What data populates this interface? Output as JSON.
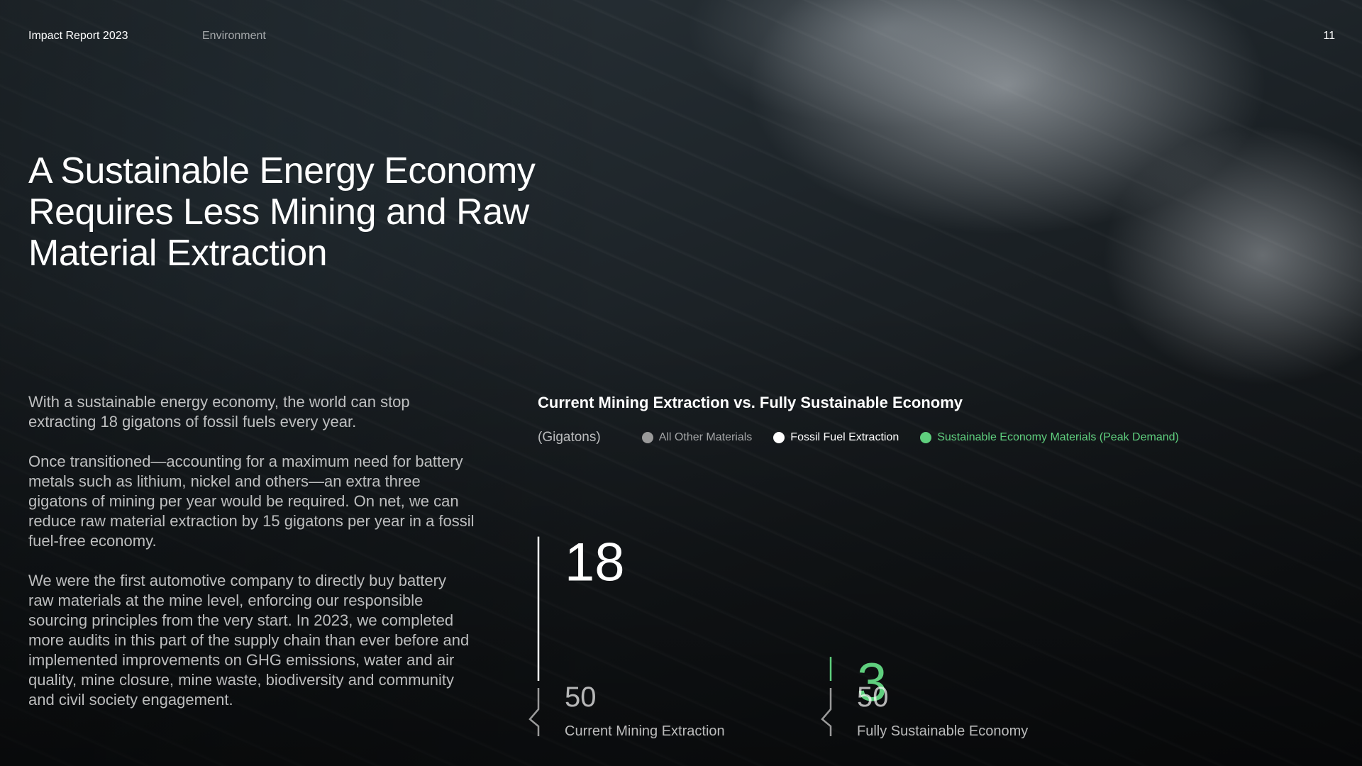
{
  "header": {
    "report_title": "Impact Report 2023",
    "section": "Environment",
    "page_number": "11"
  },
  "headline": "A Sustainable Energy Economy Requires Less Mining and Raw Material Extraction",
  "body": {
    "paragraphs": [
      "With a sustainable energy economy, the world can stop extracting 18 gigatons of fossil fuels every year.",
      "Once transitioned—accounting for a maximum need for battery metals such as lithium, nickel and others—an extra three gigatons of mining per year would be required. On net, we can reduce raw material extraction by 15 gigatons per year in a fossil fuel-free economy.",
      "We were the first automotive company to directly buy battery raw materials at the mine level, enforcing our responsible sourcing principles from the very start. In 2023, we completed more audits in this part of the supply chain than ever before and implemented improvements on GHG emissions, water and air quality, mine closure, mine waste, biodiversity and community and civil society engagement."
    ]
  },
  "colors": {
    "all_other": "#9a9a9a",
    "fossil": "#ffffff",
    "sustainable": "#5fcf7e"
  },
  "chart_data": {
    "type": "bar",
    "title": "Current Mining Extraction vs. Fully Sustainable Economy",
    "unit_label": "(Gigatons)",
    "categories": [
      "Current Mining Extraction",
      "Fully Sustainable Economy"
    ],
    "axis_break": true,
    "series": [
      {
        "name": "All Other Materials",
        "values": [
          50,
          50
        ],
        "color": "#9a9a9a"
      },
      {
        "name": "Fossil Fuel Extraction",
        "values": [
          18,
          0
        ],
        "color": "#ffffff"
      },
      {
        "name": "Sustainable Economy Materials (Peak Demand)",
        "values": [
          0,
          3
        ],
        "color": "#5fcf7e"
      }
    ],
    "data_labels": [
      {
        "category": "Current Mining Extraction",
        "series": "Fossil Fuel Extraction",
        "text": "18"
      },
      {
        "category": "Current Mining Extraction",
        "series": "All Other Materials",
        "text": "50"
      },
      {
        "category": "Fully Sustainable Economy",
        "series": "Sustainable Economy Materials (Peak Demand)",
        "text": "3"
      },
      {
        "category": "Fully Sustainable Economy",
        "series": "All Other Materials",
        "text": "50"
      }
    ]
  }
}
